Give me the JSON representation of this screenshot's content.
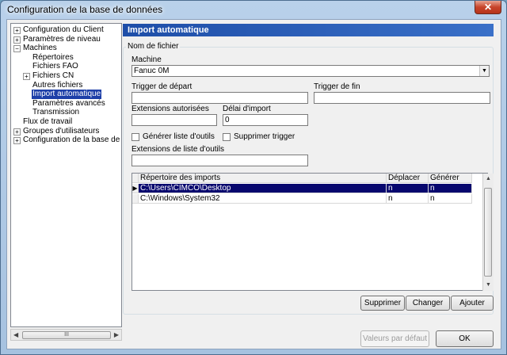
{
  "window": {
    "title": "Configuration de la base de données",
    "close": "✕"
  },
  "tree": [
    {
      "label": "Configuration du Client",
      "exp": "+",
      "level": 0
    },
    {
      "label": "Paramètres de niveau",
      "exp": "+",
      "level": 0
    },
    {
      "label": "Machines",
      "exp": "−",
      "level": 0
    },
    {
      "label": "Répertoires",
      "exp": "",
      "level": 1
    },
    {
      "label": "Fichiers FAO",
      "exp": "",
      "level": 1
    },
    {
      "label": "Fichiers CN",
      "exp": "+",
      "level": 1
    },
    {
      "label": "Autres fichiers",
      "exp": "",
      "level": 1
    },
    {
      "label": "Import automatique",
      "exp": "",
      "level": 1,
      "selected": true
    },
    {
      "label": "Paramètres avancés",
      "exp": "",
      "level": 1
    },
    {
      "label": "Transmission",
      "exp": "",
      "level": 1
    },
    {
      "label": "Flux de travail",
      "exp": "",
      "level": 0
    },
    {
      "label": "Groupes d'utilisateurs",
      "exp": "+",
      "level": 0
    },
    {
      "label": "Configuration de la base de donné",
      "exp": "+",
      "level": 0
    }
  ],
  "panel": {
    "title": "Import automatique",
    "group_title": "Nom de fichier",
    "machine_label": "Machine",
    "machine_value": "Fanuc 0M",
    "trigger_start_label": "Trigger de départ",
    "trigger_start_value": "",
    "trigger_end_label": "Trigger de fin",
    "trigger_end_value": "",
    "ext_label": "Extensions autorisées",
    "ext_value": "",
    "delay_label": "Délai d'import",
    "delay_value": "0",
    "gen_list_label": "Générer liste d'outils",
    "del_trigger_label": "Supprimer trigger",
    "tool_ext_label": "Extensions de liste d'outils",
    "tool_ext_value": ""
  },
  "grid": {
    "headers": [
      "Répertoire des imports",
      "Déplacer",
      "Générer"
    ],
    "rows": [
      {
        "dir": "C:\\Users\\CIMCO\\Desktop",
        "move": "n",
        "gen": "n",
        "selected": true
      },
      {
        "dir": "C:\\Windows\\System32",
        "move": "n",
        "gen": "n",
        "selected": false
      }
    ]
  },
  "buttons": {
    "delete": "Supprimer",
    "change": "Changer",
    "add": "Ajouter",
    "defaults": "Valeurs par défaut",
    "ok": "OK"
  },
  "scroll": {
    "h_grip": "III"
  }
}
